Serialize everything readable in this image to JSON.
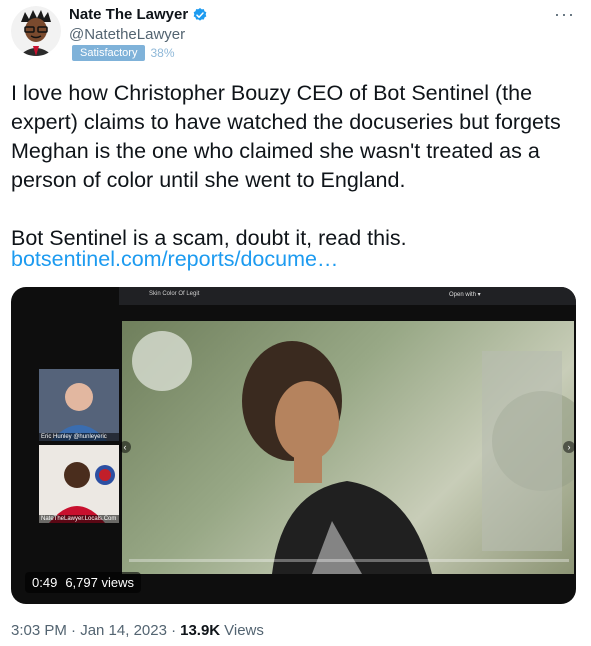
{
  "author": {
    "name": "Nate The Lawyer",
    "handle": "@NatetheLawyer",
    "badge_label": "Satisfactory",
    "badge_pct": "38%",
    "verified_color": "#1d9bf0"
  },
  "tweet": {
    "body": "I love how Christopher Bouzy CEO of Bot Sentinel (the expert) claims to have watched the docuseries but forgets Meghan is the one who claimed she wasn't treated as a person of color until she went to England.\n\nBot Sentinel is a scam, doubt it, read this.",
    "link": "botsentinel.com/reports/docume…"
  },
  "media": {
    "duration": "0:49",
    "views": "6,797 views",
    "screen_label": "Skin Color Of Legit",
    "open_with": "Open with ▾",
    "cam1_caption": "Eric Hunley @hunleyeric",
    "cam2_caption": "NateTheLawyer.Locals.Com",
    "progress": 0.0
  },
  "footer": {
    "time": "3:03 PM · Jan 14, 2023 ·",
    "views_count": "13.9K",
    "views_label": "Views"
  },
  "icons": [
    "more-icon",
    "verified-icon",
    "avatar"
  ]
}
